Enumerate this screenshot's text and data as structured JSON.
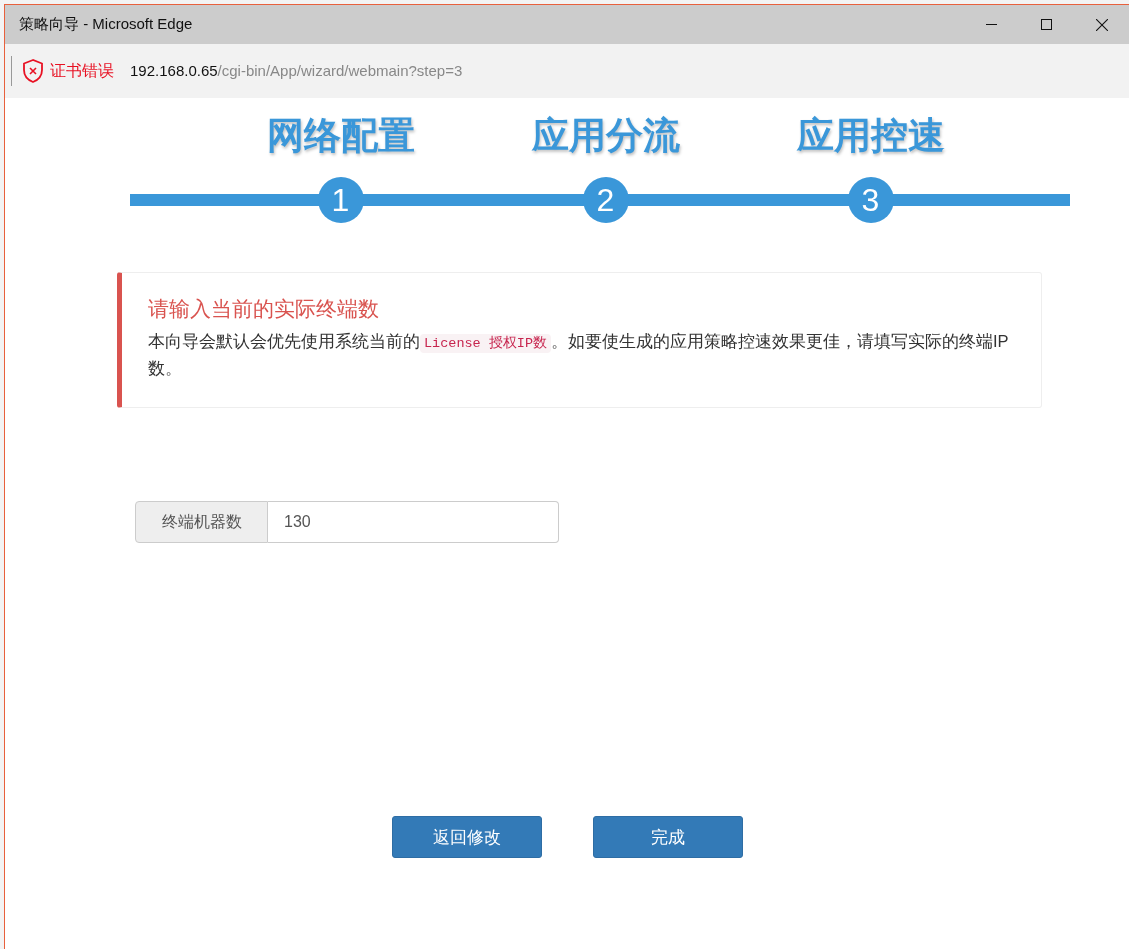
{
  "window": {
    "title": "策略向导 - Microsoft Edge"
  },
  "address_bar": {
    "security_warning": "证书错误",
    "url_host": "192.168.0.65",
    "url_path": "/cgi-bin/App/wizard/webmain?step=3"
  },
  "steps": [
    {
      "title": "网络配置",
      "number": "1"
    },
    {
      "title": "应用分流",
      "number": "2"
    },
    {
      "title": "应用控速",
      "number": "3"
    }
  ],
  "alert": {
    "title": "请输入当前的实际终端数",
    "message_before": "本向导会默认会优先使用系统当前的",
    "code": "License 授权IP数",
    "message_after": "。如要使生成的应用策略控速效果更佳，请填写实际的终端IP数。"
  },
  "field": {
    "label": "终端机器数",
    "value": "130"
  },
  "buttons": [
    {
      "label": "返回修改"
    },
    {
      "label": "完成"
    }
  ]
}
